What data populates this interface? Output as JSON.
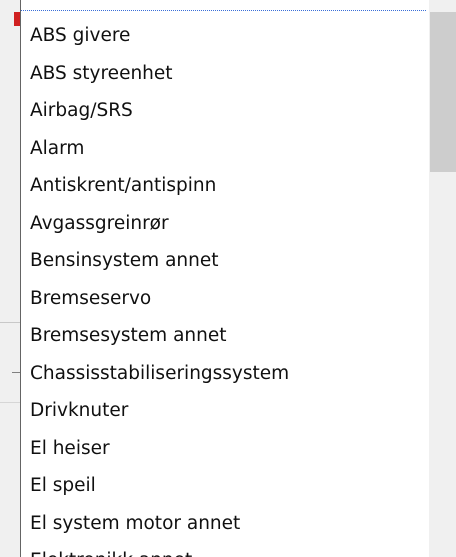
{
  "dropdown": {
    "items": [
      {
        "label": "ABS givere"
      },
      {
        "label": "ABS styreenhet"
      },
      {
        "label": "Airbag/SRS"
      },
      {
        "label": "Alarm"
      },
      {
        "label": "Antiskrent/antispinn"
      },
      {
        "label": "Avgassgreinrør"
      },
      {
        "label": "Bensinsystem annet"
      },
      {
        "label": "Bremseservo"
      },
      {
        "label": "Bremsesystem annet"
      },
      {
        "label": "Chassisstabiliseringssystem"
      },
      {
        "label": "Drivknuter"
      },
      {
        "label": "El heiser"
      },
      {
        "label": "El speil"
      },
      {
        "label": "El system motor annet"
      },
      {
        "label": "Elektronikk annet"
      }
    ]
  },
  "colors": {
    "focus_outline": "#3a6fd8",
    "scrollbar_track": "#f0f0f0",
    "scrollbar_thumb": "#cdcdcd",
    "background_marker": "#d02020"
  }
}
